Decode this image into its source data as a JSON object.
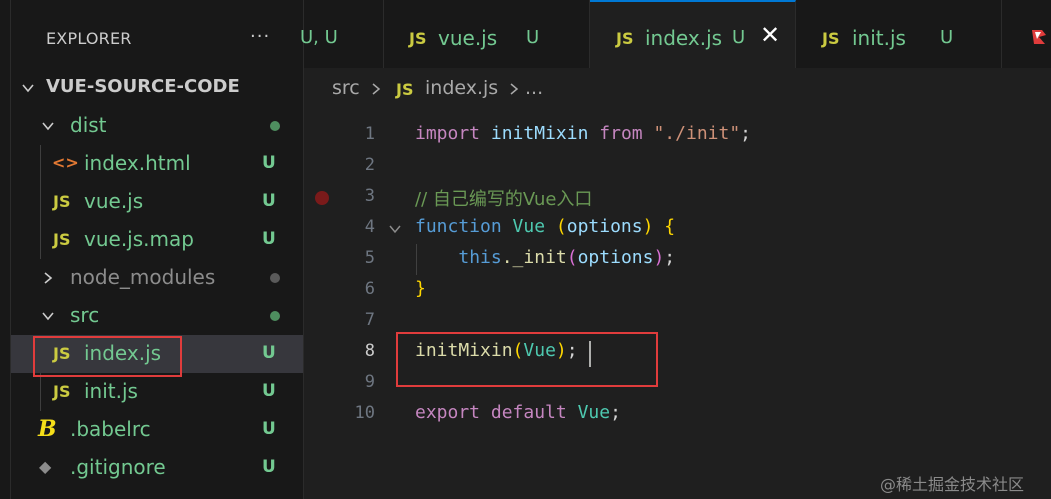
{
  "sidebar": {
    "header": "EXPLORER",
    "more": "···",
    "items": [
      {
        "label": "VUE-SOURCE-CODE",
        "kind": "root"
      },
      {
        "label": "dist",
        "kind": "folder"
      },
      {
        "label": "index.html",
        "kind": "file",
        "icon": "<>",
        "status": "U"
      },
      {
        "label": "vue.js",
        "kind": "file",
        "icon": "JS",
        "status": "U"
      },
      {
        "label": "vue.js.map",
        "kind": "file",
        "icon": "JS",
        "status": "U"
      },
      {
        "label": "node_modules",
        "kind": "folder"
      },
      {
        "label": "src",
        "kind": "folder"
      },
      {
        "label": "index.js",
        "kind": "file",
        "icon": "JS",
        "status": "U"
      },
      {
        "label": "init.js",
        "kind": "file",
        "icon": "JS",
        "status": "U"
      },
      {
        "label": ".babelrc",
        "kind": "file",
        "icon": "B",
        "status": "U"
      },
      {
        "label": ".gitignore",
        "kind": "file",
        "icon": "◆",
        "status": "U"
      }
    ]
  },
  "tabs": [
    {
      "label": "",
      "status": "U, U"
    },
    {
      "label": "vue.js",
      "icon": "JS",
      "status": "U"
    },
    {
      "label": "index.js",
      "icon": "JS",
      "status": "U",
      "active": true
    },
    {
      "label": "init.js",
      "icon": "JS",
      "status": "U"
    }
  ],
  "breadcrumb": {
    "folder": "src",
    "icon": "JS",
    "file": "index.js",
    "tail": "..."
  },
  "editor": {
    "lines": [
      {
        "n": "1"
      },
      {
        "n": "2"
      },
      {
        "n": "3"
      },
      {
        "n": "4"
      },
      {
        "n": "5"
      },
      {
        "n": "6"
      },
      {
        "n": "7"
      },
      {
        "n": "8"
      },
      {
        "n": "9"
      },
      {
        "n": "10"
      }
    ],
    "tokens": {
      "import": "import",
      "initMixin": "initMixin",
      "from": "from",
      "path": "\"./init\"",
      "semi": ";",
      "comment": "// 自己编写的Vue入口",
      "function": "function",
      "Vue": "Vue",
      "options": "options",
      "this": "this",
      "dot_init": "._init",
      "export": "export",
      "default": "default"
    }
  },
  "watermark": "@稀土掘金技术社区",
  "colors": {
    "accent": "#0078d4",
    "untracked": "#73c991",
    "highlight_box": "#e03c3c"
  }
}
